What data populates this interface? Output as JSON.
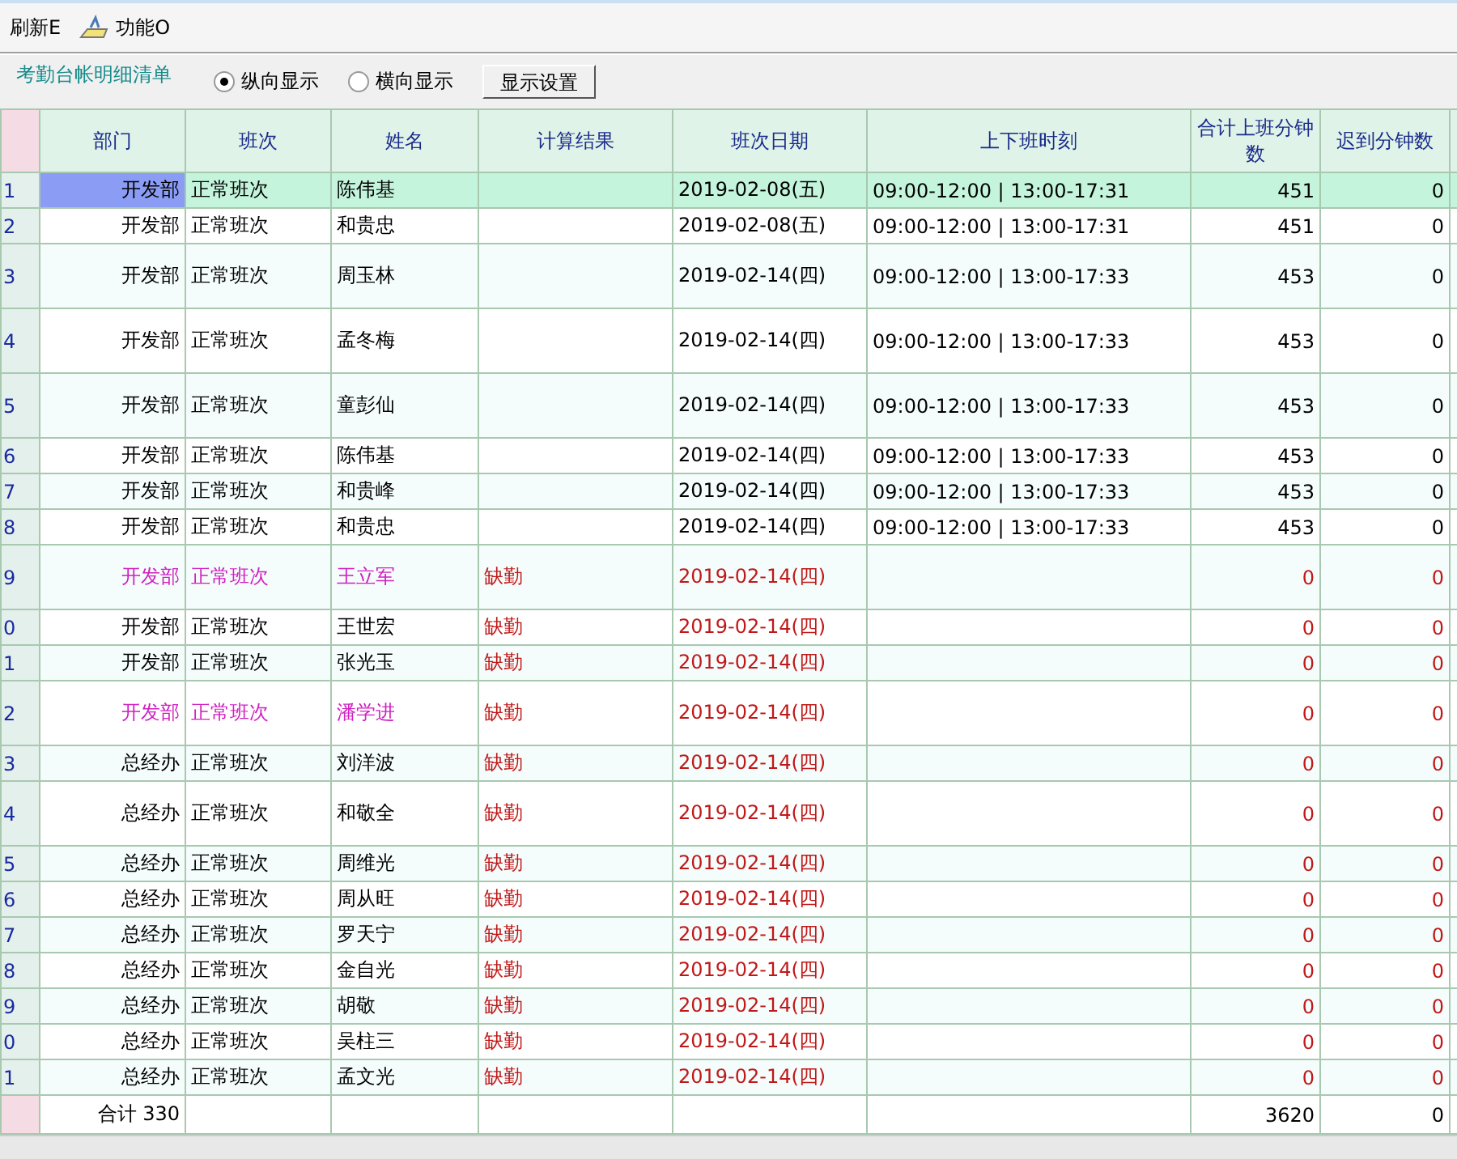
{
  "toolbar": [
    {
      "label": "刷新E",
      "icon": false
    },
    {
      "label": "功能O",
      "icon": true
    }
  ],
  "panel": {
    "title": "考勤台帐明细清单",
    "radios": [
      {
        "label": "纵向显示",
        "selected": true
      },
      {
        "label": "横向显示",
        "selected": false
      }
    ],
    "button": "显示设置"
  },
  "table": {
    "columns": [
      "部门",
      "班次",
      "姓名",
      "计算结果",
      "班次日期",
      "上下班时刻",
      "合计上班分钟数",
      "迟到分钟数"
    ],
    "rows": [
      {
        "num": "1",
        "dept": "开发部",
        "shift": "正常班次",
        "name": "陈伟基",
        "result": "",
        "date": "2019-02-08(五)",
        "times": "09:00-12:00 | 13:00-17:31",
        "minutes": "451",
        "late": "0",
        "selected": true,
        "absent": false,
        "flagged": false,
        "kind": "normal"
      },
      {
        "num": "2",
        "dept": "开发部",
        "shift": "正常班次",
        "name": "和贵忠",
        "result": "",
        "date": "2019-02-08(五)",
        "times": "09:00-12:00 | 13:00-17:31",
        "minutes": "451",
        "late": "0",
        "selected": false,
        "absent": false,
        "flagged": false,
        "kind": "normal"
      },
      {
        "num": "3",
        "dept": "开发部",
        "shift": "正常班次",
        "name": "周玉林",
        "result": "",
        "date": "2019-02-14(四)",
        "times": "09:00-12:00 | 13:00-17:33",
        "minutes": "453",
        "late": "0",
        "selected": false,
        "absent": false,
        "flagged": false,
        "kind": "tall"
      },
      {
        "num": "4",
        "dept": "开发部",
        "shift": "正常班次",
        "name": "孟冬梅",
        "result": "",
        "date": "2019-02-14(四)",
        "times": "09:00-12:00 | 13:00-17:33",
        "minutes": "453",
        "late": "0",
        "selected": false,
        "absent": false,
        "flagged": false,
        "kind": "tall"
      },
      {
        "num": "5",
        "dept": "开发部",
        "shift": "正常班次",
        "name": "童彭仙",
        "result": "",
        "date": "2019-02-14(四)",
        "times": "09:00-12:00 | 13:00-17:33",
        "minutes": "453",
        "late": "0",
        "selected": false,
        "absent": false,
        "flagged": false,
        "kind": "tall"
      },
      {
        "num": "6",
        "dept": "开发部",
        "shift": "正常班次",
        "name": "陈伟基",
        "result": "",
        "date": "2019-02-14(四)",
        "times": "09:00-12:00 | 13:00-17:33",
        "minutes": "453",
        "late": "0",
        "selected": false,
        "absent": false,
        "flagged": false,
        "kind": "normal"
      },
      {
        "num": "7",
        "dept": "开发部",
        "shift": "正常班次",
        "name": "和贵峰",
        "result": "",
        "date": "2019-02-14(四)",
        "times": "09:00-12:00 | 13:00-17:33",
        "minutes": "453",
        "late": "0",
        "selected": false,
        "absent": false,
        "flagged": false,
        "kind": "normal"
      },
      {
        "num": "8",
        "dept": "开发部",
        "shift": "正常班次",
        "name": "和贵忠",
        "result": "",
        "date": "2019-02-14(四)",
        "times": "09:00-12:00 | 13:00-17:33",
        "minutes": "453",
        "late": "0",
        "selected": false,
        "absent": false,
        "flagged": false,
        "kind": "normal"
      },
      {
        "num": "9",
        "dept": "开发部",
        "shift": "正常班次",
        "name": "王立军",
        "result": "缺勤",
        "date": "2019-02-14(四)",
        "times": "",
        "minutes": "0",
        "late": "0",
        "selected": false,
        "absent": true,
        "flagged": true,
        "kind": "tall"
      },
      {
        "num": "0",
        "dept": "开发部",
        "shift": "正常班次",
        "name": "王世宏",
        "result": "缺勤",
        "date": "2019-02-14(四)",
        "times": "",
        "minutes": "0",
        "late": "0",
        "selected": false,
        "absent": true,
        "flagged": false,
        "kind": "normal"
      },
      {
        "num": "1",
        "dept": "开发部",
        "shift": "正常班次",
        "name": "张光玉",
        "result": "缺勤",
        "date": "2019-02-14(四)",
        "times": "",
        "minutes": "0",
        "late": "0",
        "selected": false,
        "absent": true,
        "flagged": false,
        "kind": "normal"
      },
      {
        "num": "2",
        "dept": "开发部",
        "shift": "正常班次",
        "name": "潘学进",
        "result": "缺勤",
        "date": "2019-02-14(四)",
        "times": "",
        "minutes": "0",
        "late": "0",
        "selected": false,
        "absent": true,
        "flagged": true,
        "kind": "tall"
      },
      {
        "num": "3",
        "dept": "总经办",
        "shift": "正常班次",
        "name": "刘洋波",
        "result": "缺勤",
        "date": "2019-02-14(四)",
        "times": "",
        "minutes": "0",
        "late": "0",
        "selected": false,
        "absent": true,
        "flagged": false,
        "kind": "normal"
      },
      {
        "num": "4",
        "dept": "总经办",
        "shift": "正常班次",
        "name": "和敬全",
        "result": "缺勤",
        "date": "2019-02-14(四)",
        "times": "",
        "minutes": "0",
        "late": "0",
        "selected": false,
        "absent": true,
        "flagged": false,
        "kind": "tall"
      },
      {
        "num": "5",
        "dept": "总经办",
        "shift": "正常班次",
        "name": "周维光",
        "result": "缺勤",
        "date": "2019-02-14(四)",
        "times": "",
        "minutes": "0",
        "late": "0",
        "selected": false,
        "absent": true,
        "flagged": false,
        "kind": "normal"
      },
      {
        "num": "6",
        "dept": "总经办",
        "shift": "正常班次",
        "name": "周从旺",
        "result": "缺勤",
        "date": "2019-02-14(四)",
        "times": "",
        "minutes": "0",
        "late": "0",
        "selected": false,
        "absent": true,
        "flagged": false,
        "kind": "normal"
      },
      {
        "num": "7",
        "dept": "总经办",
        "shift": "正常班次",
        "name": "罗天宁",
        "result": "缺勤",
        "date": "2019-02-14(四)",
        "times": "",
        "minutes": "0",
        "late": "0",
        "selected": false,
        "absent": true,
        "flagged": false,
        "kind": "normal"
      },
      {
        "num": "8",
        "dept": "总经办",
        "shift": "正常班次",
        "name": "金自光",
        "result": "缺勤",
        "date": "2019-02-14(四)",
        "times": "",
        "minutes": "0",
        "late": "0",
        "selected": false,
        "absent": true,
        "flagged": false,
        "kind": "normal"
      },
      {
        "num": "9",
        "dept": "总经办",
        "shift": "正常班次",
        "name": "胡敬",
        "result": "缺勤",
        "date": "2019-02-14(四)",
        "times": "",
        "minutes": "0",
        "late": "0",
        "selected": false,
        "absent": true,
        "flagged": false,
        "kind": "normal"
      },
      {
        "num": "0",
        "dept": "总经办",
        "shift": "正常班次",
        "name": "吴柱三",
        "result": "缺勤",
        "date": "2019-02-14(四)",
        "times": "",
        "minutes": "0",
        "late": "0",
        "selected": false,
        "absent": true,
        "flagged": false,
        "kind": "normal"
      },
      {
        "num": "1",
        "dept": "总经办",
        "shift": "正常班次",
        "name": "孟文光",
        "result": "缺勤",
        "date": "2019-02-14(四)",
        "times": "",
        "minutes": "0",
        "late": "0",
        "selected": false,
        "absent": true,
        "flagged": false,
        "kind": "normal"
      }
    ],
    "footer": {
      "count": "合计 330",
      "minutes": "3620",
      "late": "0"
    }
  }
}
